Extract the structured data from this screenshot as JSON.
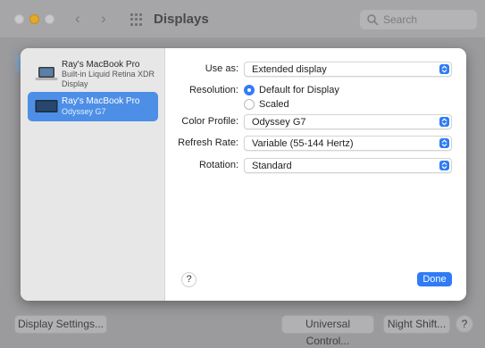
{
  "window": {
    "title": "Displays",
    "search_placeholder": "Search",
    "nav": {
      "back": "‹",
      "forward": "›"
    }
  },
  "bottom_bar": {
    "display_settings": "Display Settings...",
    "universal_control": "Universal Control...",
    "night_shift": "Night Shift...",
    "help": "?"
  },
  "sheet": {
    "displays": [
      {
        "name": "Ray's MacBook Pro",
        "subtitle": "Built-in Liquid Retina XDR Display",
        "selected": false,
        "icon": "laptop-icon"
      },
      {
        "name": "Ray's MacBook Pro",
        "subtitle": "Odyssey G7",
        "selected": true,
        "icon": "laptop-icon"
      }
    ],
    "use_as": {
      "label": "Use as:",
      "value": "Extended display"
    },
    "resolution": {
      "label": "Resolution:",
      "options": [
        {
          "label": "Default for Display",
          "selected": true
        },
        {
          "label": "Scaled",
          "selected": false
        }
      ]
    },
    "color_profile": {
      "label": "Color Profile:",
      "value": "Odyssey G7"
    },
    "refresh_rate": {
      "label": "Refresh Rate:",
      "value": "Variable (55-144 Hertz)"
    },
    "rotation": {
      "label": "Rotation:",
      "value": "Standard"
    },
    "help": "?",
    "done": "Done"
  },
  "colors": {
    "accent": "#2f7cf6",
    "selection": "#4d8fe6",
    "traffic_yellow": "#e1a928"
  }
}
